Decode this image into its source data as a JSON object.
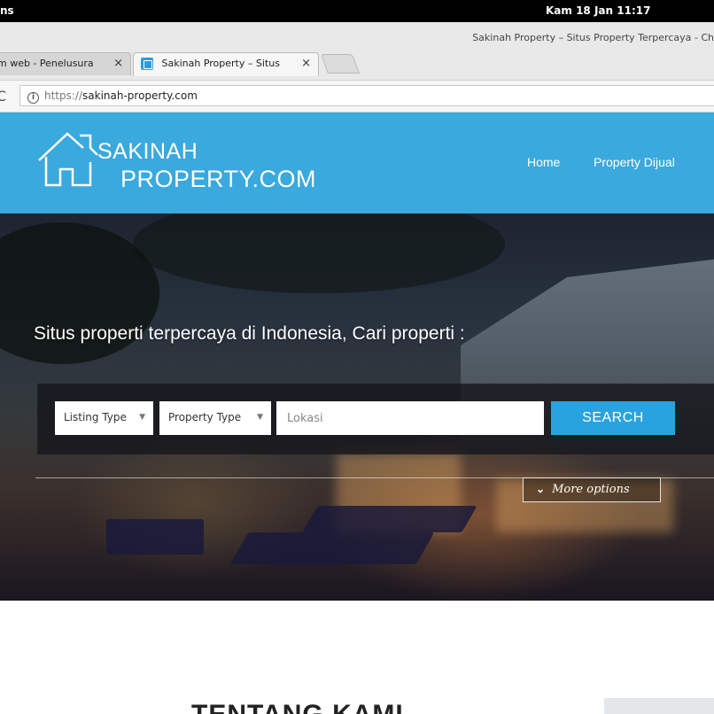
{
  "os_bar": {
    "left_text": "ns",
    "clock": "Kam 18 Jan   11:17"
  },
  "browser": {
    "window_title": "Sakinah Property – Situs Property Terpercaya - Ch",
    "tabs": [
      {
        "label": "m web - Penelusura",
        "active": false
      },
      {
        "label": "Sakinah Property – Situs",
        "active": true
      }
    ],
    "url_scheme": "https://",
    "url_host": "sakinah-property.com"
  },
  "site": {
    "logo_line1": "SAKINAH",
    "logo_line2": "PROPERTY.COM",
    "nav": [
      "Home",
      "Property Dijual"
    ],
    "brand_color": "#3aa9dd"
  },
  "hero": {
    "title": "Situs properti terpercaya di Indonesia, Cari properti :",
    "listing_type": "Listing Type",
    "property_type": "Property Type",
    "location_placeholder": "Lokasi",
    "search_label": "SEARCH",
    "more_options": "More options"
  },
  "about": {
    "title": "TENTANG KAMI"
  },
  "icons": [
    "info-icon",
    "reload-icon",
    "close-icon",
    "house-logo-icon",
    "chevron-down-icon",
    "caret-down-icon"
  ]
}
